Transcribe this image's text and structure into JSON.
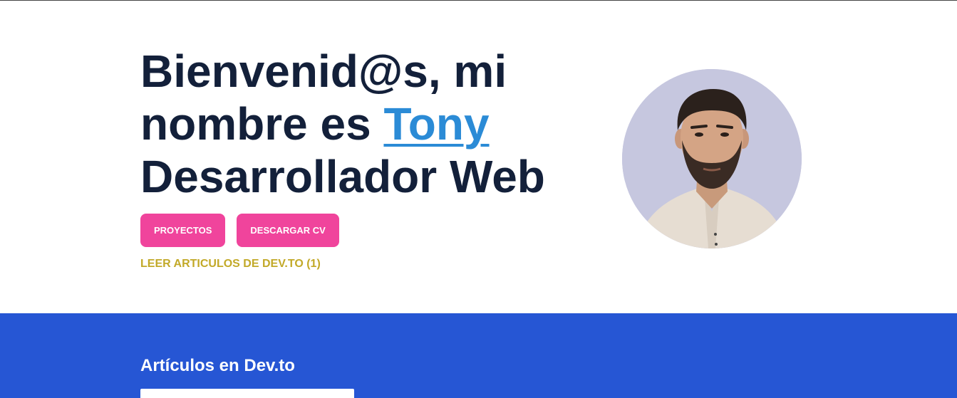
{
  "hero": {
    "line1": "Bienvenid@s, mi",
    "line2_prefix": "nombre es ",
    "name": "Tony",
    "line3": "Desarrollador Web",
    "buttons": {
      "projects": "PROYECTOS",
      "download_cv": "DESCARGAR CV"
    },
    "articles_link": "LEER ARTICULOS DE DEV.TO (1)"
  },
  "articles_section": {
    "title": "Artículos en Dev.to"
  },
  "colors": {
    "heading": "#13203a",
    "accent_link": "#2b8bd6",
    "button": "#f0449c",
    "gold_link": "#c2a928",
    "section_bg": "#2656d4"
  }
}
